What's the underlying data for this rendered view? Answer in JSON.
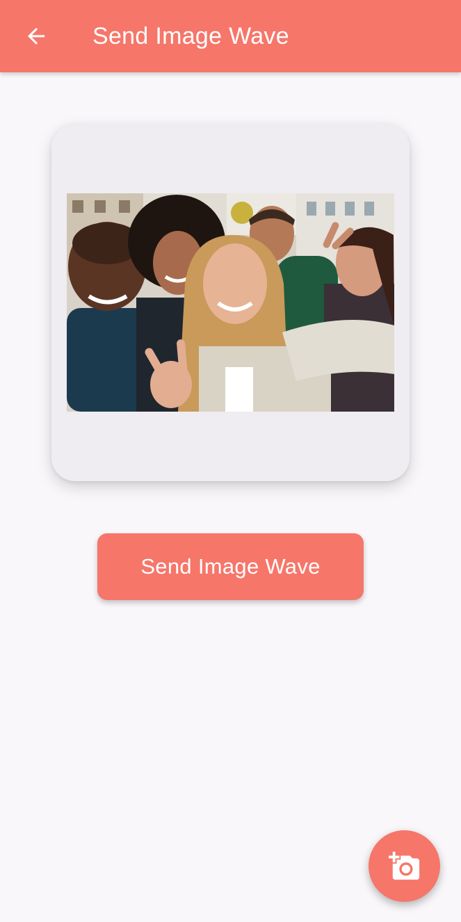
{
  "app_bar": {
    "title": "Send Image Wave",
    "back_icon": "arrow-back-icon"
  },
  "preview": {
    "image_description_icon": "group-selfie-photo"
  },
  "actions": {
    "send_label": "Send Image Wave",
    "fab_icon": "add-a-photo-icon"
  },
  "colors": {
    "primary": "#f6766a",
    "background": "#f9f7fa",
    "card": "#efedf1",
    "on_primary": "#ffffff"
  }
}
